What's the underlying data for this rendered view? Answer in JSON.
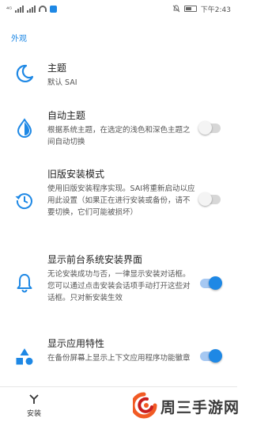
{
  "status_bar": {
    "time": "下午2:43",
    "network_label": "⁴ᴳ"
  },
  "section": {
    "title": "外观"
  },
  "settings": [
    {
      "title": "主题",
      "summary": "默认 SAI"
    },
    {
      "title": "自动主题",
      "summary": "根据系统主题，在选定的浅色和深色主题之间自动切换",
      "switch": false
    },
    {
      "title": "旧版安装模式",
      "summary": "使用旧版安装程序实现。SAI将重新启动以应用此设置（如果正在进行安装或备份，请不要切换，它们可能被损坏）",
      "switch": false
    },
    {
      "title": "显示前台系统安装界面",
      "summary": "无论安装成功与否，一律显示安装对话框。您可以通过点击安装会话项手动打开这些对话框。只对新安装生效",
      "switch": true
    },
    {
      "title": "显示应用特性",
      "summary": "在备份屏幕上显示上下文应用程序功能徽章",
      "switch": true
    }
  ],
  "nav": {
    "install_label": "安装"
  },
  "watermark": {
    "text": "周三手游网"
  },
  "colors": {
    "accent": "#1e88e5",
    "logo_orange": "#f15a24",
    "logo_red": "#c81e1e",
    "watermark_text": "#3a3a3a"
  }
}
